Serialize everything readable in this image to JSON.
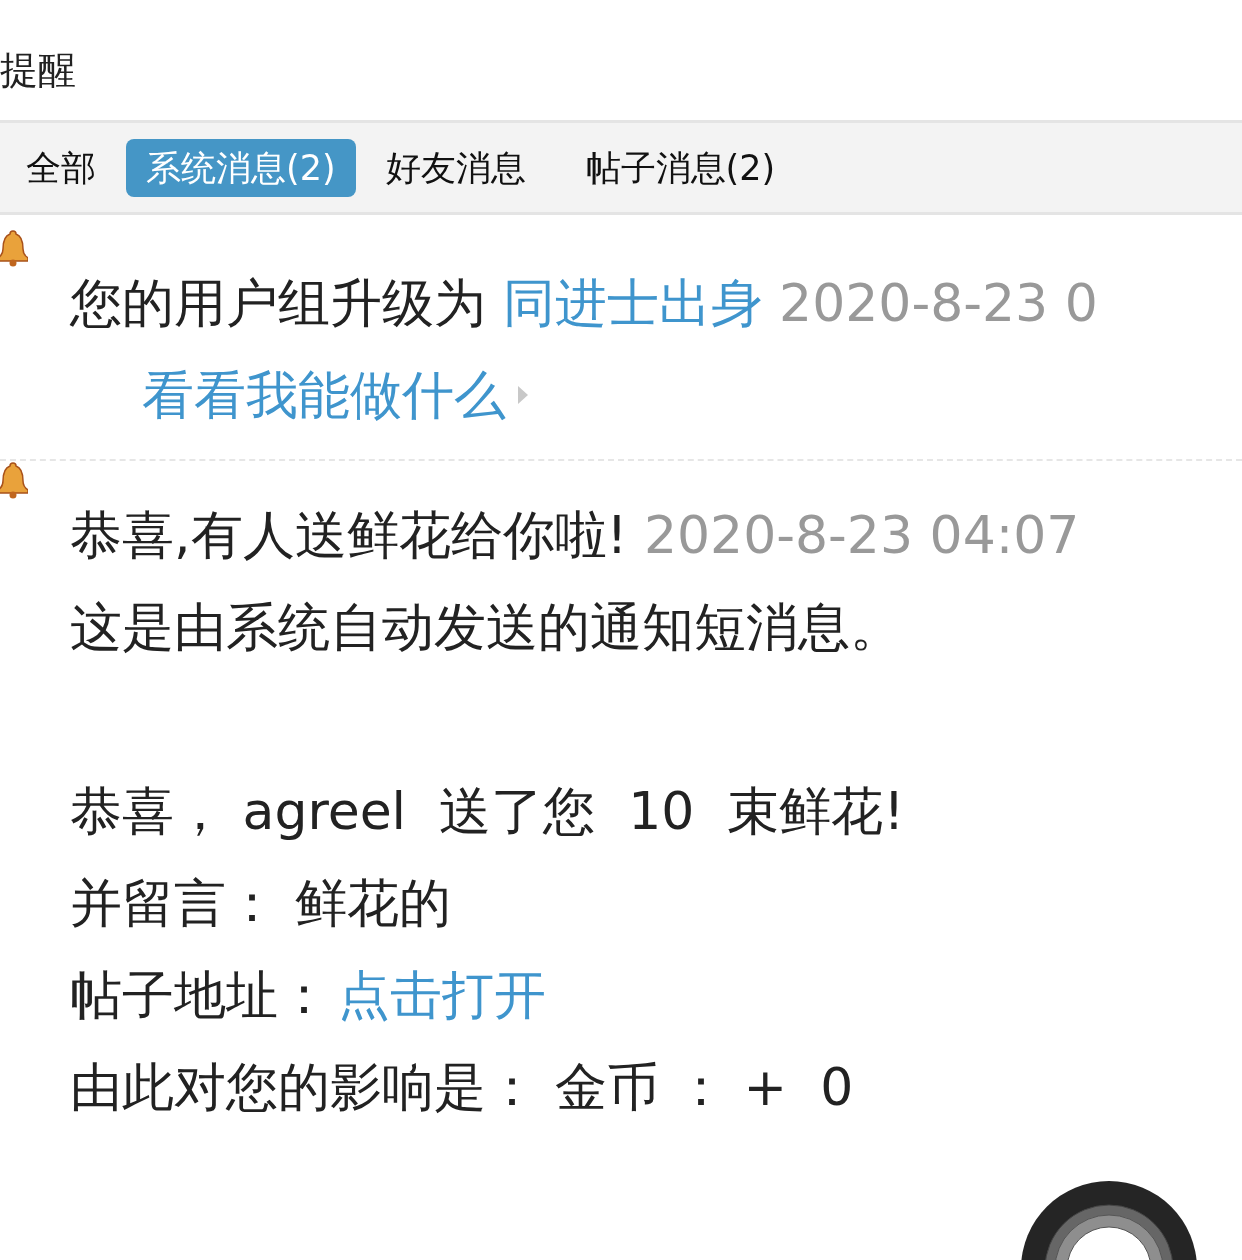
{
  "header": {
    "title": "提醒"
  },
  "tabs": [
    {
      "label": "全部",
      "selected": false
    },
    {
      "label": "系统消息(2)",
      "selected": true
    },
    {
      "label": "好友消息",
      "selected": false
    },
    {
      "label": "帖子消息(2)",
      "selected": false
    }
  ],
  "messages": [
    {
      "kind": "upgrade",
      "text": "您的用户组升级为",
      "group": "同进士出身",
      "time": "2020-8-23 0",
      "link": "看看我能做什么"
    },
    {
      "kind": "flowers",
      "title": "恭喜,有人送鲜花给你啦!",
      "time": "2020-8-23 04:07",
      "body": [
        {
          "lines": [
            {
              "text": "这是由系统自动发送的通知短消息。"
            }
          ]
        },
        {
          "lines": [
            {
              "text": "恭喜， agreel  送了您  10  束鲜花!"
            },
            {
              "text": "并留言： 鲜花的"
            },
            {
              "text": "帖子地址：",
              "link": "点击打开"
            },
            {
              "text": "由此对您的影响是： 金币 ： +  0"
            }
          ]
        }
      ]
    }
  ]
}
